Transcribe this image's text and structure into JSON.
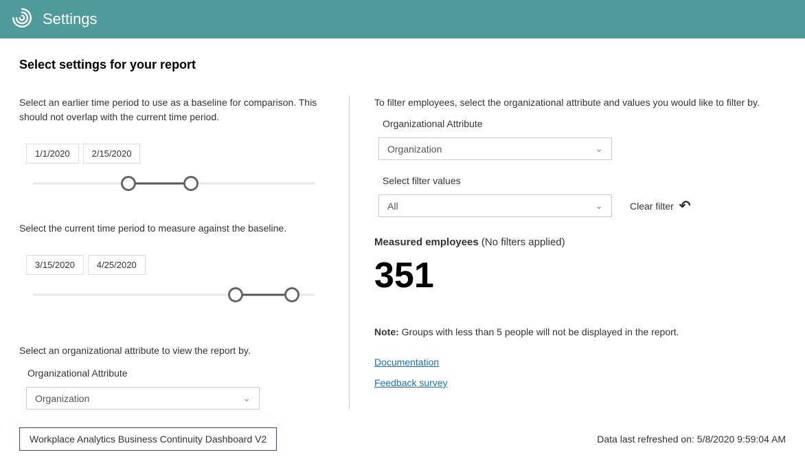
{
  "header": {
    "title": "Settings"
  },
  "page_title": "Select settings for your report",
  "left": {
    "baseline_help": "Select an earlier time period to use as a baseline for comparison. This should not overlap with the current time period.",
    "baseline_start": "1/1/2020",
    "baseline_end": "2/15/2020",
    "current_help": "Select the current time period to measure against the baseline.",
    "current_start": "3/15/2020",
    "current_end": "4/25/2020",
    "org_attr_help": "Select an organizational attribute to view the report by.",
    "org_attr_label": "Organizational Attribute",
    "org_attr_value": "Organization"
  },
  "right": {
    "filter_help": "To filter employees, select the organizational attribute and values you would like to filter by.",
    "org_attr_label": "Organizational Attribute",
    "org_attr_value": "Organization",
    "filter_values_label": "Select filter values",
    "filter_values_value": "All",
    "clear_filter_label": "Clear filter",
    "measured_label": "Measured employees",
    "measured_status": "(No filters applied)",
    "measured_count": "351",
    "note_prefix": "Note:",
    "note_text": " Groups with less than 5 people will not be displayed in the report.",
    "doc_link": "Documentation",
    "feedback_link": "Feedback survey"
  },
  "footer": {
    "dashboard_name": "Workplace Analytics Business Continuity Dashboard V2",
    "refreshed_label": "Data last refreshed on: ",
    "refreshed_value": "5/8/2020 9:59:04 AM"
  },
  "slider": {
    "baseline": {
      "left_pct": 34,
      "right_pct": 56
    },
    "current": {
      "left_pct": 72,
      "right_pct": 92
    }
  }
}
